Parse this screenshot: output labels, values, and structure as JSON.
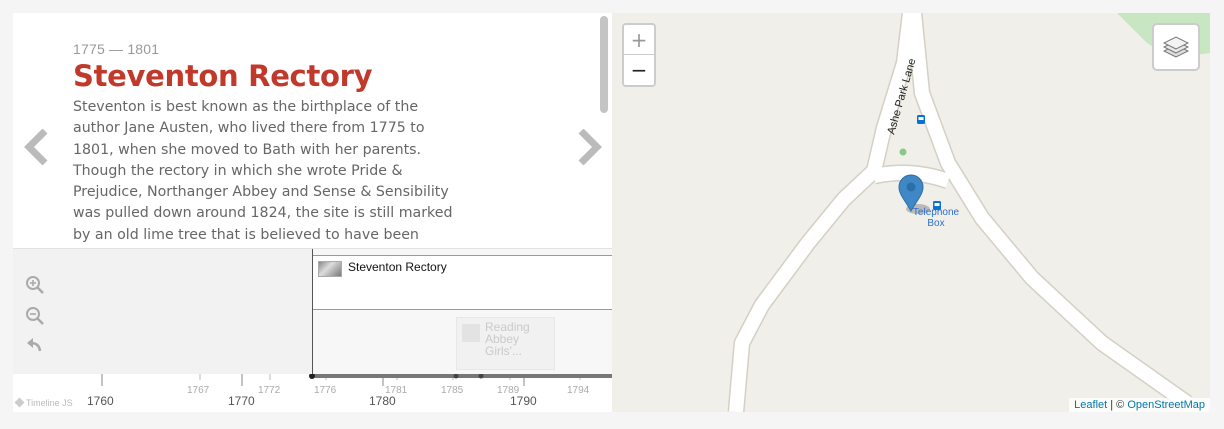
{
  "slide": {
    "date": "1775 — 1801",
    "title": "Steventon Rectory",
    "body": "Steventon is best known as the birthplace of the author Jane Austen, who lived there from 1775 to 1801, when she moved to Bath with her parents. Though the rectory in which she wrote Pride & Prejudice, Northanger Abbey and Sense & Sensibility was pulled down around 1824, the site is still marked by an old lime tree that is believed to have been"
  },
  "markers": {
    "active": "Steventon Rectory",
    "faded": "Reading Abbey Girls'..."
  },
  "axis": {
    "major": [
      "1760",
      "1770",
      "1780",
      "1790"
    ],
    "minor": [
      "1767",
      "1772",
      "1776",
      "1781",
      "1785",
      "1789",
      "1794"
    ]
  },
  "credit": "Timeline JS",
  "map": {
    "zoom_in": "+",
    "zoom_out": "−",
    "road_label": "Ashe Park Lane",
    "poi_label_line1": "Telephone",
    "poi_label_line2": "Box",
    "attribution": {
      "leaflet": "Leaflet",
      "sep": " | © ",
      "osm": "OpenStreetMap"
    }
  },
  "colors": {
    "title": "#c0392b",
    "marker_pin": "#3f88c5",
    "link": "#0078a8",
    "bus_icon": "#0a6fd6"
  }
}
